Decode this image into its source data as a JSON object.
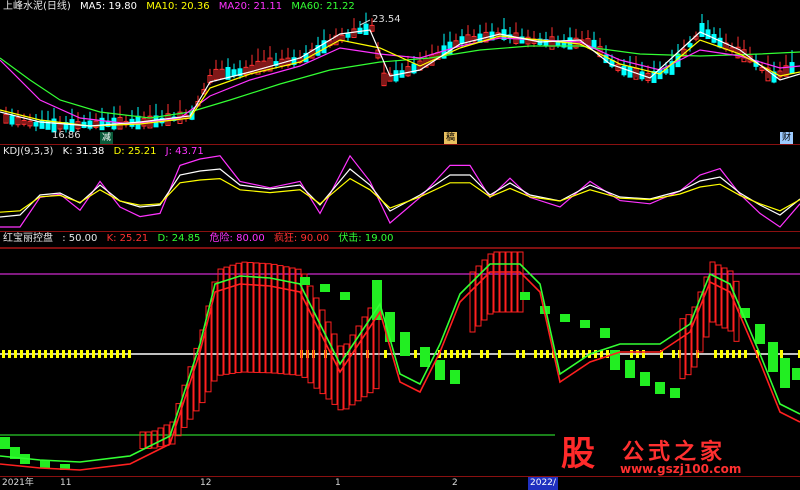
{
  "main_panel": {
    "title": "上峰水泥(日线)",
    "ma": [
      {
        "label": "MA5: 19.80",
        "color": "#ffffff"
      },
      {
        "label": "MA10: 20.36",
        "color": "#ffff00"
      },
      {
        "label": "MA20: 21.11",
        "color": "#ff33ff"
      },
      {
        "label": "MA60: 21.22",
        "color": "#33ff33"
      }
    ],
    "high_label": "23.54",
    "low_label": "16.86",
    "badges": [
      {
        "text": "减",
        "color": "#ffffff",
        "bg": "#0a5a3a"
      },
      {
        "text": "稿",
        "color": "#000000",
        "bg": "#e8c060"
      },
      {
        "text": "财",
        "color": "#000000",
        "bg": "#9ecbff"
      }
    ]
  },
  "kdj_panel": {
    "title": "KDJ(9,3,3)",
    "k": "K: 31.38",
    "d": "D: 25.21",
    "j": "J: 43.71"
  },
  "hb_panel": {
    "title": "红宝丽控盘",
    "value": ": 50.00",
    "k": "K: 25.21",
    "d": "D: 24.85",
    "danger": "危险: 80.00",
    "crazy": "疯狂: 90.00",
    "ambush": "伏击: 19.00"
  },
  "time_axis": [
    "2021年",
    "11",
    "12",
    "1",
    "2",
    "2022/"
  ],
  "watermark": {
    "char": "股",
    "name": "公式之家",
    "url": "www.gszj100.com"
  },
  "colors": {
    "separator": "#8a1010",
    "up": "#ff3030",
    "down": "#00ffff",
    "kdj_k": "#ffffff",
    "kdj_d": "#ffff00",
    "kdj_j": "#ff33ff",
    "hb_red": "#ff2020",
    "hb_green": "#33ff33",
    "hb_bar_green": "#22ee22"
  }
}
